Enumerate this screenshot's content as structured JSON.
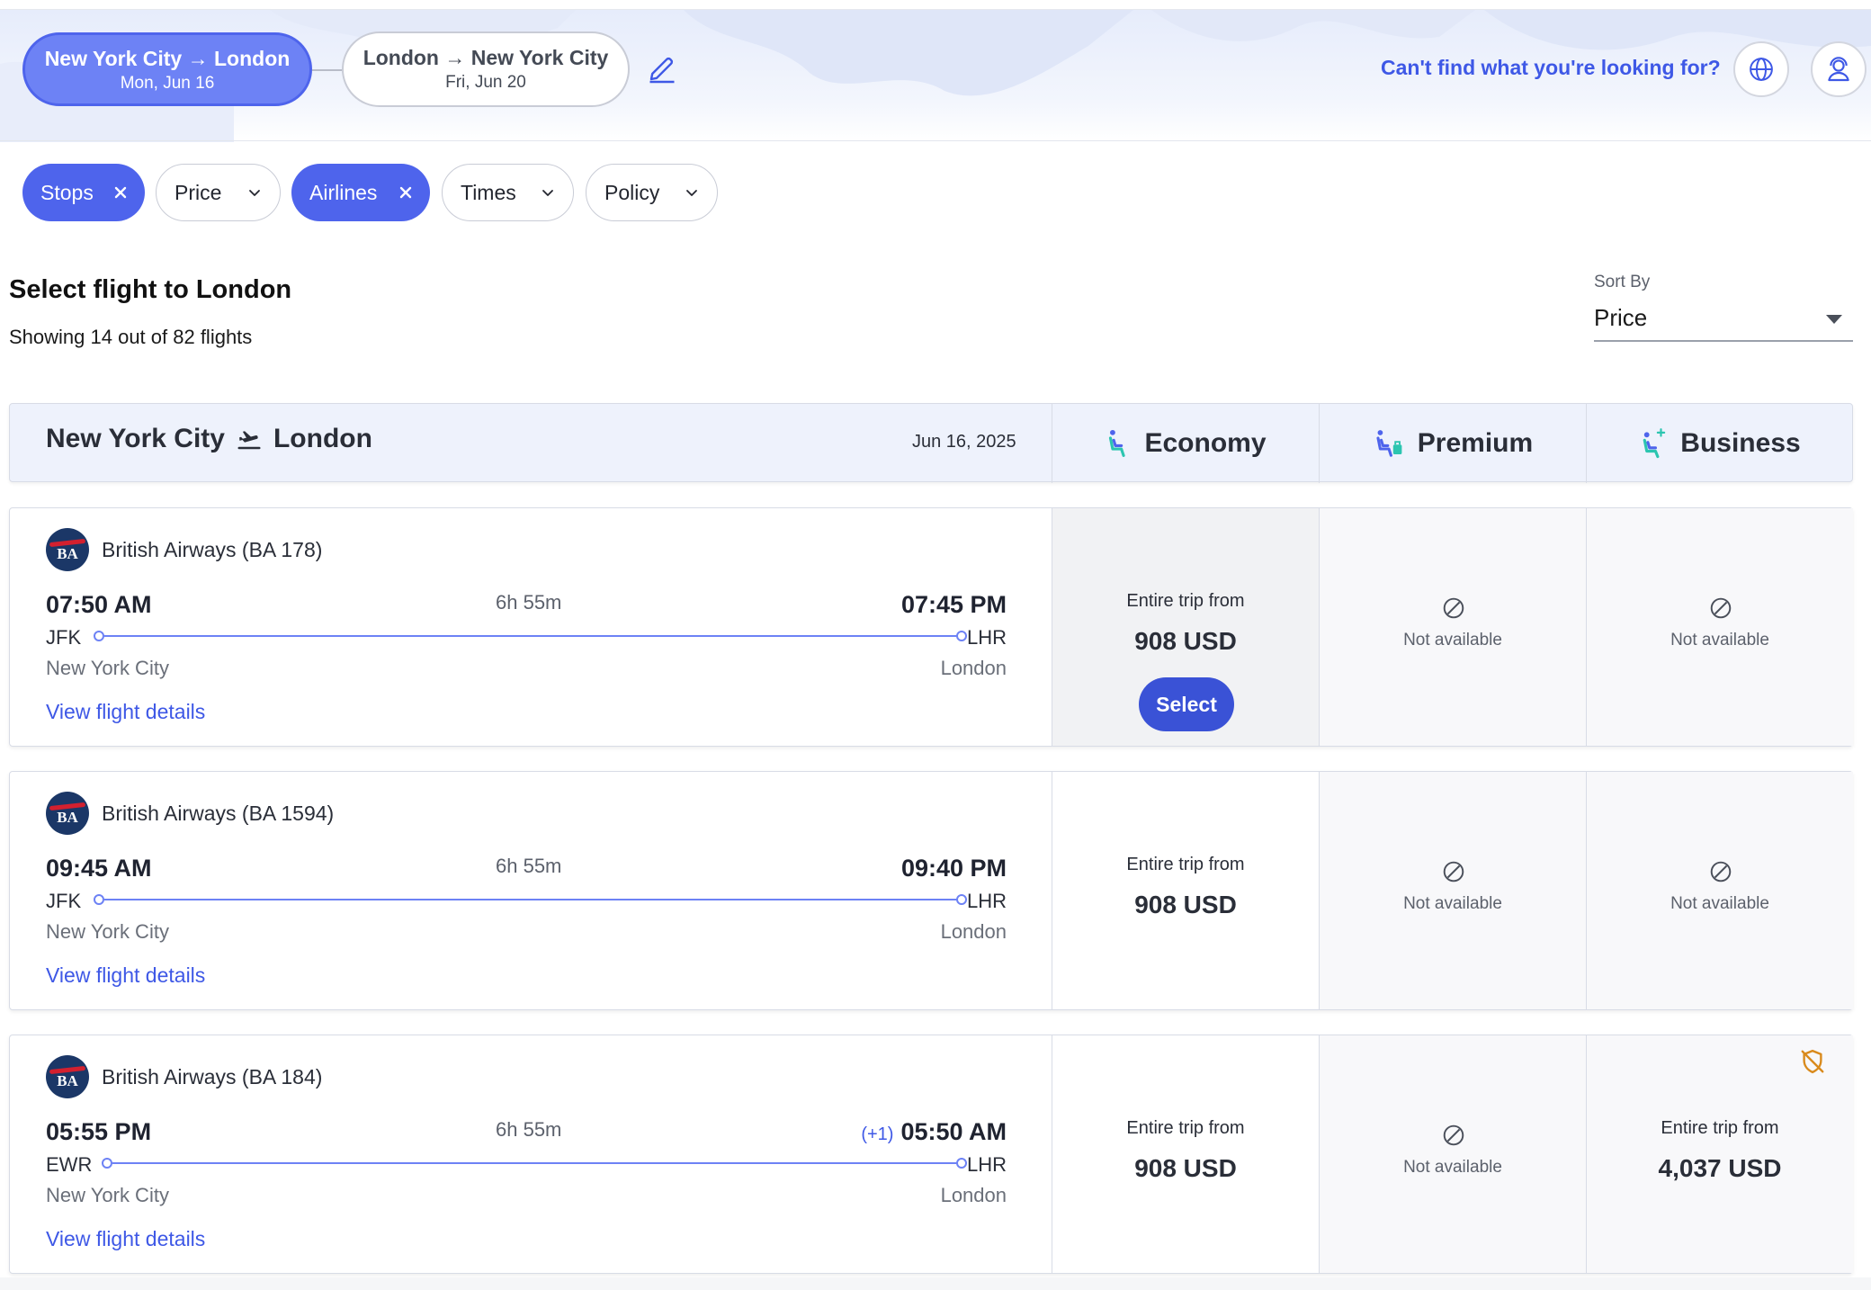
{
  "trip": {
    "outbound": {
      "route": "New York City → London",
      "date": "Mon, Jun 16"
    },
    "return": {
      "route": "London → New York City",
      "date": "Fri, Jun 20"
    }
  },
  "header": {
    "help_link": "Can't find what you're looking for?",
    "icons": [
      "edit-icon",
      "globe-icon",
      "agent-icon"
    ]
  },
  "filters": [
    {
      "label": "Stops",
      "active": true
    },
    {
      "label": "Price",
      "active": false
    },
    {
      "label": "Airlines",
      "active": true
    },
    {
      "label": "Times",
      "active": false
    },
    {
      "label": "Policy",
      "active": false
    }
  ],
  "results": {
    "title": "Select flight to London",
    "count_text": "Showing 14 out of 82 flights"
  },
  "sort": {
    "label": "Sort By",
    "value": "Price"
  },
  "table_header": {
    "origin": "New York City",
    "destination": "London",
    "date": "Jun 16, 2025",
    "cabins": [
      "Economy",
      "Premium",
      "Business"
    ]
  },
  "flights": [
    {
      "airline": "British Airways (BA 178)",
      "logo_text": "BA",
      "dep_time": "07:50 AM",
      "arr_time": "07:45 PM",
      "day_offset": "",
      "duration": "6h 55m",
      "dep_airport": "JFK",
      "arr_airport": "LHR",
      "dep_city": "New York City",
      "arr_city": "London",
      "details_link": "View flight details",
      "fares": [
        {
          "type": "price",
          "from": "Entire trip from",
          "price": "908 USD",
          "selected": true,
          "button": "Select"
        },
        {
          "type": "na",
          "text": "Not available"
        },
        {
          "type": "na",
          "text": "Not available"
        }
      ]
    },
    {
      "airline": "British Airways (BA 1594)",
      "logo_text": "BA",
      "dep_time": "09:45 AM",
      "arr_time": "09:40 PM",
      "day_offset": "",
      "duration": "6h 55m",
      "dep_airport": "JFK",
      "arr_airport": "LHR",
      "dep_city": "New York City",
      "arr_city": "London",
      "details_link": "View flight details",
      "fares": [
        {
          "type": "price",
          "from": "Entire trip from",
          "price": "908 USD"
        },
        {
          "type": "na",
          "text": "Not available"
        },
        {
          "type": "na",
          "text": "Not available"
        }
      ]
    },
    {
      "airline": "British Airways (BA 184)",
      "logo_text": "BA",
      "dep_time": "05:55 PM",
      "arr_time": "05:50 AM",
      "day_offset": "(+1)",
      "duration": "6h 55m",
      "dep_airport": "EWR",
      "arr_airport": "LHR",
      "dep_city": "New York City",
      "arr_city": "London",
      "details_link": "View flight details",
      "fares": [
        {
          "type": "price",
          "from": "Entire trip from",
          "price": "908 USD"
        },
        {
          "type": "na",
          "text": "Not available"
        },
        {
          "type": "price",
          "from": "Entire trip from",
          "price": "4,037 USD",
          "out_of_policy": true
        }
      ]
    }
  ],
  "colors": {
    "accent": "#4e64ec",
    "link": "#3e58e6",
    "select_button": "#3a52d6",
    "policy_warning": "#d98a1c"
  }
}
